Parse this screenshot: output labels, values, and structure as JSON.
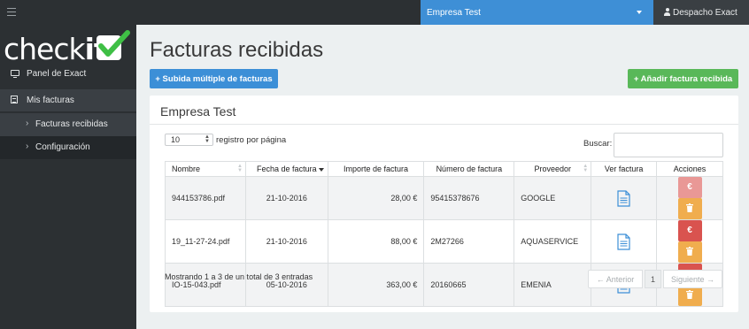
{
  "topbar": {
    "company": "Empresa Test",
    "user": "Despacho Exact"
  },
  "logo": {
    "text_light": "check",
    "text_bold": "it"
  },
  "sidebar": {
    "items": [
      {
        "label": "Panel de Exact",
        "icon": "desktop-icon"
      },
      {
        "label": "Mis facturas",
        "icon": "document-icon"
      },
      {
        "label": "Facturas recibidas",
        "icon": "chevron-right-icon"
      },
      {
        "label": "Configuración",
        "icon": "chevron-right-icon"
      }
    ]
  },
  "page": {
    "title": "Facturas recibidas",
    "bulk_upload_label": "+ Subida múltiple de facturas",
    "add_label": "+ Añadir factura recibida"
  },
  "panel": {
    "title": "Empresa Test",
    "page_length": "10",
    "page_length_label": "registro por página",
    "search_label": "Buscar:",
    "search_value": ""
  },
  "table": {
    "columns": [
      "Nombre",
      "Fecha de factura",
      "Importe de factura",
      "Número de factura",
      "Proveedor",
      "Ver factura",
      "Acciones"
    ],
    "rows": [
      {
        "nombre": "944153786.pdf",
        "fecha": "21-10-2016",
        "importe": "28,00 €",
        "numero": "95415378676",
        "proveedor": "GOOGLE"
      },
      {
        "nombre": "19_11-27-24.pdf",
        "fecha": "21-10-2016",
        "importe": "88,00 €",
        "numero": "2M27266",
        "proveedor": "AQUASERVICE"
      },
      {
        "nombre": "IO-15-043.pdf",
        "fecha": "05-10-2016",
        "importe": "363,00 €",
        "numero": "20160665",
        "proveedor": "EMENIA"
      }
    ],
    "euro_symbol": "€"
  },
  "footer": {
    "info": "Mostrando 1 a 3 de un total de 3 entradas",
    "prev": "← Anterior",
    "page": "1",
    "next": "Siguiente →"
  },
  "colors": {
    "topbar": "#2c3033",
    "company_select": "#3e8fd6",
    "primary_button": "#3c8fd7",
    "success_button": "#59b859",
    "danger": "#d9534f",
    "warning": "#f0ad4e",
    "logo_check": "#3fbf45"
  }
}
